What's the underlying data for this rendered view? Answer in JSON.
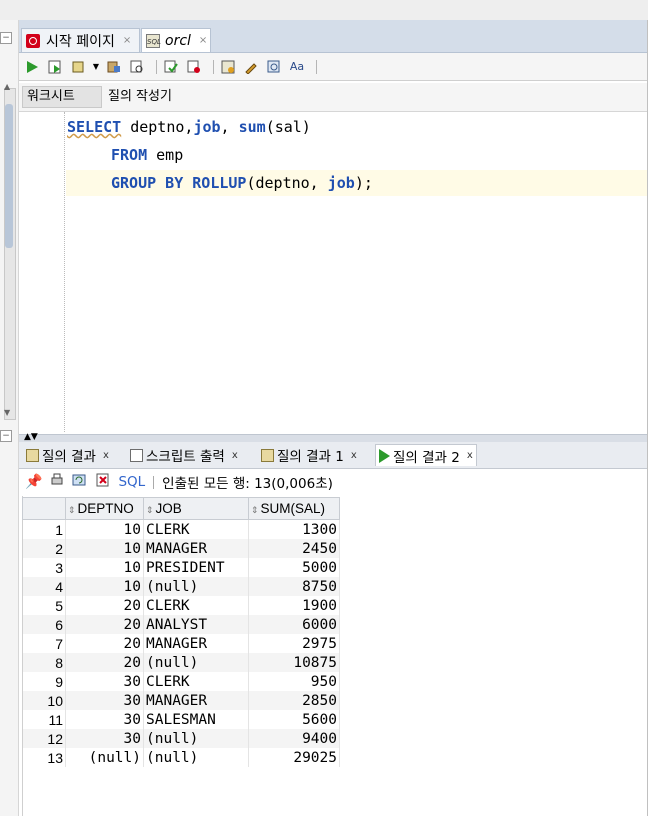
{
  "document_tabs": [
    {
      "label": "시작 페이지",
      "icon": "oracle-start-icon",
      "active": false
    },
    {
      "label": "orcl",
      "icon": "sql-worksheet-icon",
      "active": true
    }
  ],
  "toolbar": {
    "buttons": [
      "run-statement-icon",
      "run-script-icon",
      "commit-icon",
      "rollback-icon",
      "autotrace-icon",
      "explain-plan-icon",
      "sql-tuning-icon",
      "clear-icon",
      "sql-history-icon",
      "format-icon"
    ]
  },
  "subtabs": {
    "worksheet": "워크시트",
    "query_builder": "질의 작성기"
  },
  "editor": {
    "line1": {
      "kw1": "SELECT",
      "t1": " deptno,",
      "f1": "job",
      "t2": ", ",
      "f2": "sum",
      "t3": "(sal)"
    },
    "line2": {
      "kw1": "FROM",
      "t1": " emp"
    },
    "line3": {
      "kw1": "GROUP BY ROLLUP",
      "t1": "(deptno, ",
      "f1": "job",
      "t2": ");"
    }
  },
  "result_tabs": [
    {
      "label": "질의 결과",
      "icon": "query-result-icon",
      "active": false
    },
    {
      "label": "스크립트 출력",
      "icon": "script-output-icon",
      "active": false
    },
    {
      "label": "질의 결과 1",
      "icon": "query-result-icon",
      "active": false
    },
    {
      "label": "질의 결과 2",
      "icon": "run-result-icon",
      "active": true
    }
  ],
  "status": {
    "sql_label": "SQL",
    "message": "인출된 모든 행: 13(0,006초)"
  },
  "grid": {
    "columns": [
      "DEPTNO",
      "JOB",
      "SUM(SAL)"
    ],
    "rows": [
      {
        "n": "1",
        "deptno": "10",
        "job": "CLERK",
        "sum": "1300"
      },
      {
        "n": "2",
        "deptno": "10",
        "job": "MANAGER",
        "sum": "2450"
      },
      {
        "n": "3",
        "deptno": "10",
        "job": "PRESIDENT",
        "sum": "5000"
      },
      {
        "n": "4",
        "deptno": "10",
        "job": "(null)",
        "sum": "8750"
      },
      {
        "n": "5",
        "deptno": "20",
        "job": "CLERK",
        "sum": "1900"
      },
      {
        "n": "6",
        "deptno": "20",
        "job": "ANALYST",
        "sum": "6000"
      },
      {
        "n": "7",
        "deptno": "20",
        "job": "MANAGER",
        "sum": "2975"
      },
      {
        "n": "8",
        "deptno": "20",
        "job": "(null)",
        "sum": "10875"
      },
      {
        "n": "9",
        "deptno": "30",
        "job": "CLERK",
        "sum": "950"
      },
      {
        "n": "10",
        "deptno": "30",
        "job": "MANAGER",
        "sum": "2850"
      },
      {
        "n": "11",
        "deptno": "30",
        "job": "SALESMAN",
        "sum": "5600"
      },
      {
        "n": "12",
        "deptno": "30",
        "job": "(null)",
        "sum": "9400"
      },
      {
        "n": "13",
        "deptno": "(null)",
        "job": "(null)",
        "sum": "29025"
      }
    ]
  },
  "colors": {
    "keyword": "#1f4fb0",
    "run_green": "#2c9a2c",
    "oracle_red": "#d2001a",
    "tabbar": "#d4dde9"
  }
}
